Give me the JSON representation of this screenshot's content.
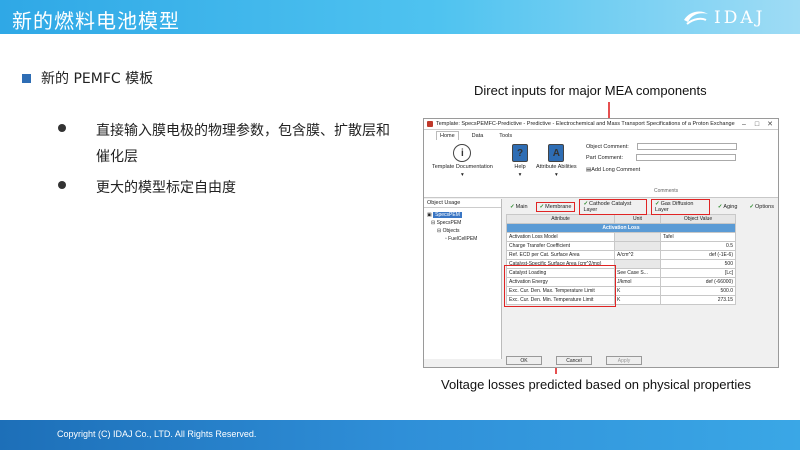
{
  "header": {
    "title": "新的燃料电池模型",
    "logo_text": "IDAJ"
  },
  "slide": {
    "main_bullet": "新的 PEMFC 模板",
    "sub_bullets": [
      "直接输入膜电极的物理参数，包含膜、扩散层和催化层",
      "更大的模型标定自由度"
    ]
  },
  "annotations": {
    "top": "Direct inputs for major MEA components",
    "bottom": "Voltage losses predicted based on physical properties"
  },
  "window": {
    "title": "Template: SpecsPEMFC-Predictive - Predictive - Electrochemical and Mass Transport Specifications of a Proton Exchange Me...",
    "ribbon_tabs": [
      "Home",
      "Data",
      "Tools"
    ],
    "ribbon": {
      "template_doc": "Template Documentation",
      "help": "Help",
      "attr_abilities": "Attribute Abilities",
      "object_comment": "Object Comment:",
      "part_comment": "Part Comment:",
      "add_long_comment": "Add Long Comment",
      "comments_group": "Comments"
    },
    "left_pane": {
      "title": "Object Usage",
      "tree": [
        "SpecsPEM",
        "SpecsPEM",
        "Objects",
        "FuelCellPEM"
      ]
    },
    "tabs": [
      "Main",
      "Membrane",
      "Cathode Catalyst Layer",
      "Gas Diffusion Layer",
      "Aging",
      "Options"
    ],
    "table": {
      "headers": [
        "Attribute",
        "Unit",
        "Object Value"
      ],
      "section": "Activation Loss",
      "rows": [
        [
          "Activation Loss Model",
          "",
          "Tafel"
        ],
        [
          "Charge Transfer Coefficient",
          "",
          "0.5"
        ],
        [
          "Ref. ECD per Cat. Surface Area",
          "A/cm^2",
          "def (-1E-6)"
        ],
        [
          "Catalyst-Specific Surface Area (cm^2/mg)",
          "",
          "500"
        ],
        [
          "Catalyst Loading",
          "See Case S...",
          "[Lc]"
        ],
        [
          "Activation Energy",
          "J/kmol",
          "def (-66000)"
        ],
        [
          "Exc. Cur. Den. Max. Temperature Limit",
          "K",
          "500.0"
        ],
        [
          "Exc. Cur. Den. Min. Temperature Limit",
          "K",
          "273.15"
        ]
      ]
    },
    "buttons": {
      "ok": "OK",
      "cancel": "Cancel",
      "apply": "Apply"
    }
  },
  "footer": {
    "text": "Copyright (C) IDAJ Co., LTD. All Rights Reserved."
  },
  "colors": {
    "header": "#2fa8e6",
    "footer": "#1d6fb8",
    "highlight": "#e02424"
  }
}
